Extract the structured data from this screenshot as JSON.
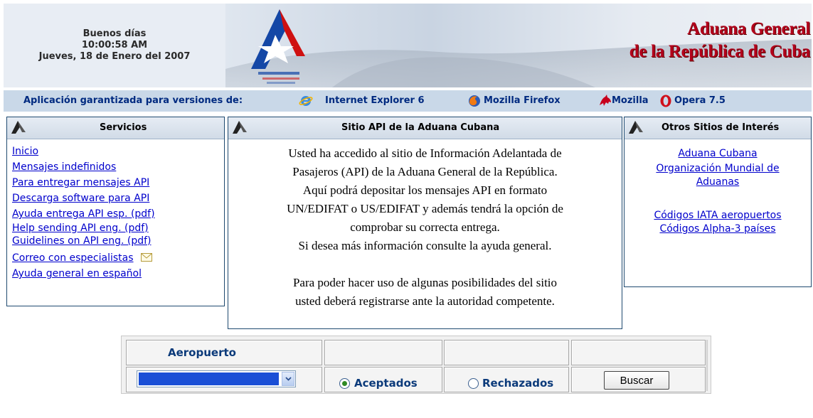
{
  "header": {
    "greeting": "Buenos días",
    "time": "10:00:58 AM",
    "date": "Jueves, 18 de Enero del 2007",
    "agency_line1": "Aduana General",
    "agency_line2": "de la República de Cuba"
  },
  "browser_bar": {
    "label": "Aplicación garantizada para versiones de:",
    "browsers": [
      {
        "name": "Internet Explorer 6",
        "icon": "internet-explorer-icon"
      },
      {
        "name": "Mozilla Firefox",
        "icon": "firefox-icon"
      },
      {
        "name": "Mozilla",
        "icon": "mozilla-icon"
      },
      {
        "name": "Opera 7.5",
        "icon": "opera-icon"
      }
    ]
  },
  "servicios": {
    "title": "Servicios",
    "items": [
      "Inicio",
      "Mensajes indefinidos",
      "Para entregar mensajes API",
      "Descarga software para API",
      "Ayuda entrega API esp. (pdf)",
      "Help sending API eng. (pdf)",
      "Guidelines on API eng. (pdf)",
      "Correo con especialistas",
      "Ayuda general en español"
    ]
  },
  "sitio": {
    "title": "Sitio API de la Aduana Cubana",
    "lines": [
      "Usted ha accedido al sitio de Información Adelantada de",
      "Pasajeros (API) de la Aduana General de la República.",
      "Aquí podrá depositar los mensajes API en formato",
      "UN/EDIFAT o US/EDIFAT y además tendrá la opción de",
      "comprobar su correcta entrega.",
      "Si desea más información consulte la ayuda general.",
      "Para poder hacer uso de algunas posibilidades del sitio",
      "usted deberá registrarse ante la autoridad competente."
    ]
  },
  "otros": {
    "title": "Otros Sitios de Interés",
    "links": [
      "Aduana Cubana",
      "Organización Mundial de",
      "Aduanas",
      "Códigos IATA aeropuertos",
      "Códigos Alpha-3 países"
    ]
  },
  "form": {
    "aeropuerto_label": "Aeropuerto",
    "aceptados": "Aceptados",
    "rechazados": "Rechazados",
    "buscar": "Buscar",
    "selected": "aceptados"
  },
  "colors": {
    "agency_red": "#b3001b",
    "bar_bg": "#c9d8e8",
    "link": "#0000cc",
    "label_blue": "#0b3a7a"
  }
}
